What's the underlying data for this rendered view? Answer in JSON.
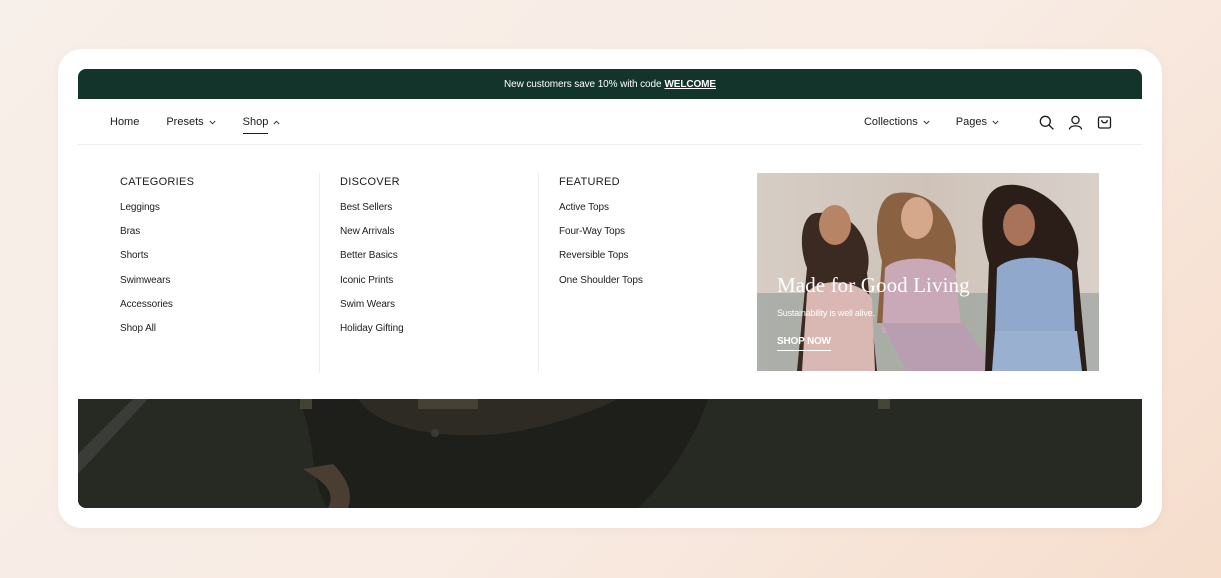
{
  "announcement": {
    "text": "New customers save 10% with code",
    "code": "WELCOME"
  },
  "nav": {
    "left": [
      {
        "label": "Home",
        "has_menu": false
      },
      {
        "label": "Presets",
        "has_menu": true
      },
      {
        "label": "Shop",
        "has_menu": true,
        "active": true
      }
    ],
    "right": [
      {
        "label": "Collections",
        "has_menu": true
      },
      {
        "label": "Pages",
        "has_menu": true
      }
    ],
    "icons": [
      "search-icon",
      "account-icon",
      "cart-icon"
    ]
  },
  "mega_menu": {
    "columns": [
      {
        "heading": "CATEGORIES",
        "links": [
          "Leggings",
          "Bras",
          "Shorts",
          "Swimwears",
          "Accessories",
          "Shop All"
        ]
      },
      {
        "heading": "DISCOVER",
        "links": [
          "Best Sellers",
          "New Arrivals",
          "Better Basics",
          "Iconic Prints",
          "Swim Wears",
          "Holiday Gifting"
        ]
      },
      {
        "heading": "FEATURED",
        "links": [
          "Active Tops",
          "Four-Way Tops",
          "Reversible Tops",
          "One Shoulder Tops"
        ]
      }
    ],
    "promo": {
      "title": "Made for Good Living",
      "subtitle": "Sustainability is well alive.",
      "cta": "SHOP NOW"
    }
  },
  "colors": {
    "announcement_bg": "#13342a",
    "hero_bg": "#262a23",
    "text": "#1b1b1b"
  }
}
